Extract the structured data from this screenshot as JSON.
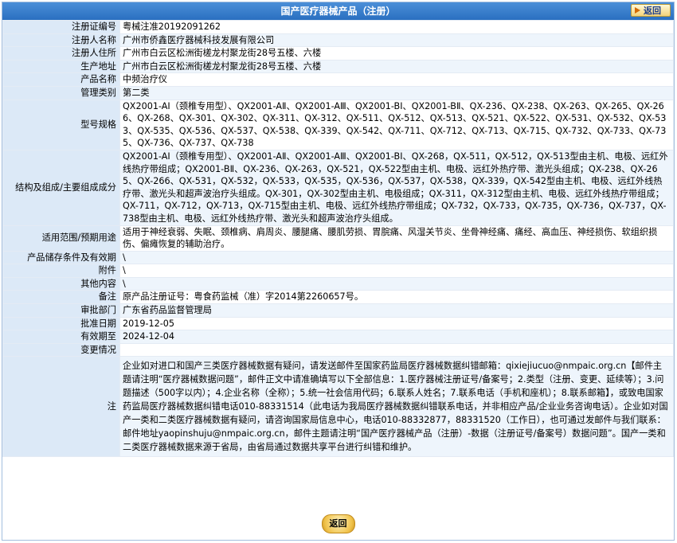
{
  "header": {
    "title": "国产医疗器械产品（注册）",
    "back_label": "返回"
  },
  "rows": [
    {
      "label": "注册证编号",
      "value": "粤械注准20192091262"
    },
    {
      "label": "注册人名称",
      "value": "广州市侨鑫医疗器械科技发展有限公司"
    },
    {
      "label": "注册人住所",
      "value": "广州市白云区松洲街槎龙村聚龙街28号五楼、六楼"
    },
    {
      "label": "生产地址",
      "value": "广州市白云区松洲街槎龙村聚龙街28号五楼、六楼"
    },
    {
      "label": "产品名称",
      "value": "中频治疗仪"
    },
    {
      "label": "管理类别",
      "value": "第二类"
    },
    {
      "label": "型号规格",
      "value": "QX2001-AⅠ（颈椎专用型）、QX2001-AⅡ、QX2001-AⅢ、QX2001-BⅠ、QX2001-BⅡ、QX-236、QX-238、QX-263、QX-265、QX-266、QX-268、QX-301、QX-302、QX-311、QX-312、QX-511、QX-512、QX-513、QX-521、QX-522、QX-531、QX-532、QX-533、QX-535、QX-536、QX-537、QX-538、QX-339、QX-542、QX-711、QX-712、QX-713、QX-715、QX-732、QX-733、QX-735、QX-736、QX-737、QX-738"
    },
    {
      "label": "结构及组成/主要组成成分",
      "value": "QX2001-AⅠ（颈椎专用型）、QX2001-AⅡ、QX2001-AⅢ、QX2001-BⅠ、QX-268，QX-511，QX-512，QX-513型由主机、电极、远红外线热疗带组成；QX2001-BⅡ、QX-236、QX-263，QX-521，QX-522型由主机、电极、远红外热疗带、激光头组成；QX-238、QX-265、QX-266、QX-531，QX-532，QX-533，QX-535，QX-536，QX-537，QX-538，QX-339，QX-542型由主机、电极、远红外线热疗带、激光头和超声波治疗头组成。QX-301，QX-302型由主机、电极组成；QX-311，QX-312型由主机、电极、远红外线热疗带组成；QX-711，QX-712，QX-713，QX-715型由主机、电极、远红外线热疗带组成；QX-732，QX-733，QX-735，QX-736，QX-737，QX-738型由主机、电极、远红外线热疗带、激光头和超声波治疗头组成。"
    },
    {
      "label": "适用范围/预期用途",
      "value": "适用于神经衰弱、失眠、颈椎病、肩周炎、腰腿痛、腰肌劳损、胃脘痛、风湿关节炎、坐骨神经痛、痛经、高血压、神经损伤、软组织损伤、偏瘫恢复的辅助治疗。"
    },
    {
      "label": "产品储存条件及有效期",
      "value": "\\"
    },
    {
      "label": "附件",
      "value": "\\"
    },
    {
      "label": "其他内容",
      "value": "\\"
    },
    {
      "label": "备注",
      "value": "原产品注册证号：粤食药监械（准）字2014第2260657号。"
    },
    {
      "label": "审批部门",
      "value": "广东省药品监督管理局"
    },
    {
      "label": "批准日期",
      "value": "2019-12-05"
    },
    {
      "label": "有效期至",
      "value": "2024-12-04"
    },
    {
      "label": "变更情况",
      "value": ""
    },
    {
      "label": "注",
      "value": "企业如对进口和国产三类医疗器械数据有疑问，请发送邮件至国家药监局医疗器械数据纠错邮箱：qixiejiucuo@nmpaic.org.cn【邮件主题请注明“医疗器械数据问题”，邮件正文中请准确填写以下全部信息：1.医疗器械注册证号/备案号；2.类型（注册、变更、延续等）；3.问题描述（500字以内）；4.企业名称（全称）；5.统一社会信用代码；6.联系人姓名；7.联系电话（手机和座机）；8.联系邮箱】，或致电国家药监局医疗器械数据纠错电话010-88331514（此电话为我局医疗器械数据纠错联系电话，并非相应产品/企业业务咨询电话）。企业如对国产一类和二类医疗器械数据有疑问，请咨询国家局信息中心，电话010-88332877，88331520（工作日），也可通过发邮件与我们联系：邮件地址yaopinshuju@nmpaic.org.cn，邮件主题请注明“国产医疗器械产品（注册）-数据（注册证号/备案号）数据问题”。国产一类和二类医疗器械数据来源于省局，由省局通过数据共享平台进行纠错和维护。"
    }
  ],
  "footer": {
    "back_label": "返回"
  }
}
